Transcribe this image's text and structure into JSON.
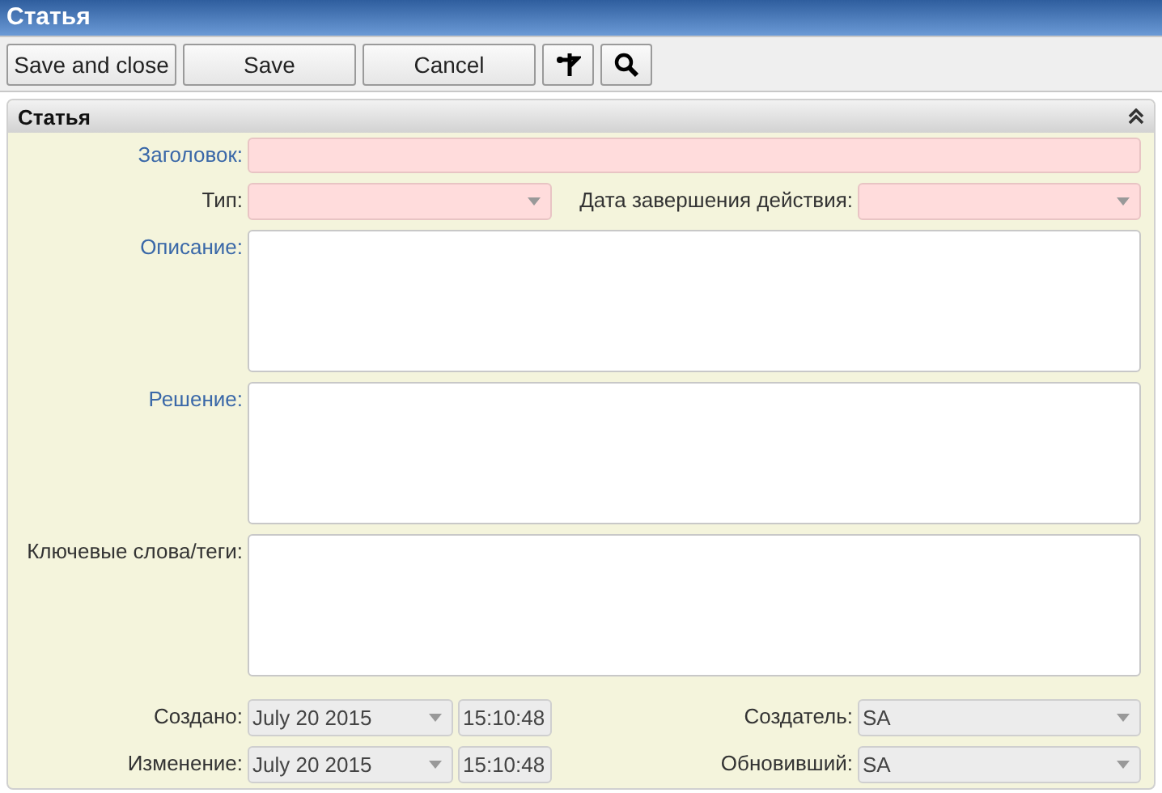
{
  "window": {
    "title": "Статья"
  },
  "toolbar": [
    {
      "kind": "text",
      "label": "Save and close"
    },
    {
      "kind": "text",
      "label": "Save"
    },
    {
      "kind": "text",
      "label": "Cancel"
    },
    {
      "kind": "pin"
    },
    {
      "kind": "search"
    }
  ],
  "panel": {
    "title": "Статья",
    "expanded": true
  },
  "rows": [
    {
      "kind": "text",
      "label": "Заголовок:",
      "accent": true,
      "required": true
    },
    {
      "kind": "pair",
      "label": "Тип:",
      "accent": false,
      "required": true,
      "label_2": "Дата завершения действия:",
      "required_2": true
    },
    {
      "kind": "area",
      "label": "Описание:",
      "accent": true,
      "required": false
    },
    {
      "kind": "area",
      "label": "Решение:",
      "accent": true,
      "required": false
    },
    {
      "kind": "area",
      "label": "Ключевые слова/теги:",
      "accent": false,
      "required": false
    }
  ],
  "meta": [
    {
      "label": "Создано:",
      "date": "July 20 2015",
      "time": "15:10:48",
      "label_2": "Создатель:",
      "value_2": "SA"
    },
    {
      "label": "Изменение:",
      "date": "July 20 2015",
      "time": "15:10:48",
      "label_2": "Обновивший:",
      "value_2": "SA"
    }
  ]
}
